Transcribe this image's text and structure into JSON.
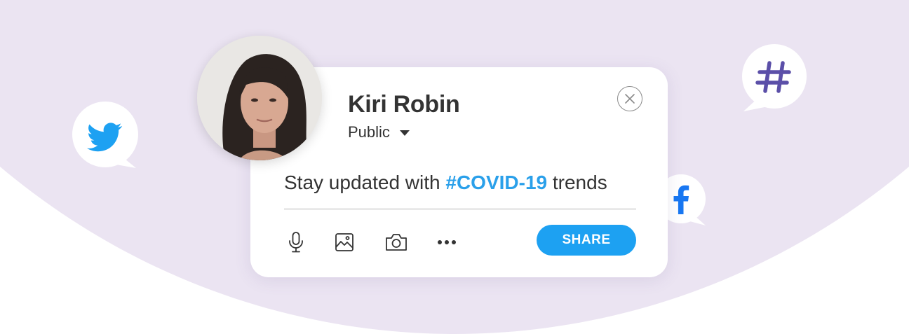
{
  "post": {
    "author": "Kiri Robin",
    "audience": "Public",
    "text_before": "Stay updated with ",
    "hashtag": "#COVID-19",
    "text_after": " trends",
    "share_label": "SHARE"
  },
  "toolbar": {
    "icons": [
      "microphone-icon",
      "image-icon",
      "camera-icon",
      "more-icon"
    ]
  },
  "social_bubbles": [
    "twitter-icon",
    "facebook-icon",
    "hashtag-icon"
  ],
  "colors": {
    "background_shape": "#ebe4f2",
    "accent_blue": "#1da1f2",
    "hashtag_blue": "#2aa0ea",
    "facebook_blue": "#1877f2",
    "hashtag_purple": "#5b4fa8",
    "text": "#333333"
  }
}
